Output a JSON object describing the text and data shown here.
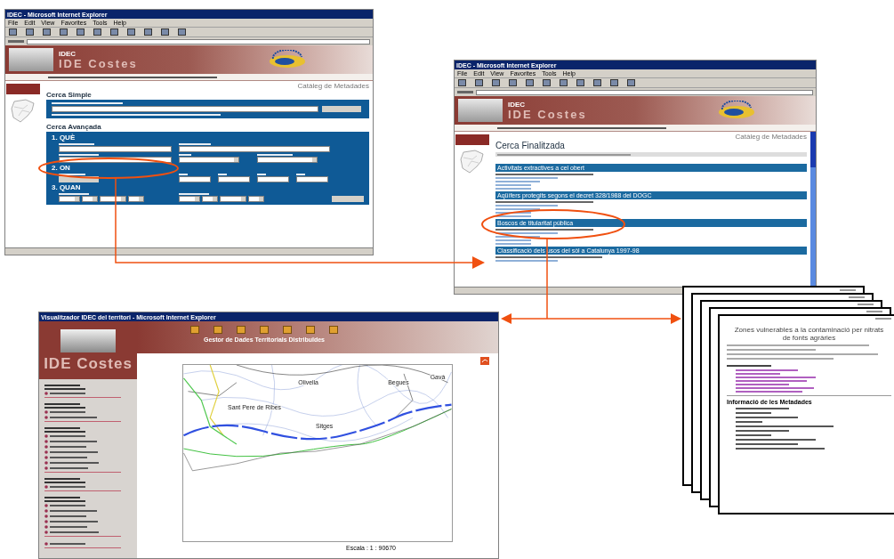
{
  "search_window": {
    "chrome": {
      "title": "IDEC - Microsoft Internet Explorer",
      "menu": [
        "File",
        "Edit",
        "View",
        "Favorites",
        "Tools",
        "Help"
      ]
    },
    "site": {
      "org": "IDEC",
      "name": "IDE Costes",
      "section": "Catàleg de Metadades"
    },
    "simple": {
      "heading": "Cerca Simple"
    },
    "advanced": {
      "heading": "Cerca Avançada",
      "steps": [
        "1. QUÈ",
        "2. ON",
        "3. QUAN"
      ]
    }
  },
  "results_window": {
    "chrome": {
      "title": "IDEC - Microsoft Internet Explorer",
      "menu": [
        "File",
        "Edit",
        "View",
        "Favorites",
        "Tools",
        "Help"
      ]
    },
    "site": {
      "org": "IDEC",
      "name": "IDE Costes",
      "section": "Catàleg de Metadades"
    },
    "heading": "Cerca Finalitzada",
    "results": [
      "Activitats extractives a cel obert",
      "Aqüífers protegits segons el decret 328/1988 del DOGC",
      "Boscos de titularitat pública",
      "Classificació dels usos del sòl a Catalunya 1997-98"
    ]
  },
  "viewer_window": {
    "title": "Visualitzador IDEC del territori - Microsoft Internet Explorer",
    "site_name": "IDE Costes",
    "header": "Gestor de Dades Territorials Distribuïdes",
    "places": [
      "Olivella",
      "Begues",
      "Gavà",
      "Sant Pere de Ribes",
      "Sitges"
    ],
    "scale": "Escala : 1 : 90670"
  },
  "documents": {
    "title": "Zones vulnerables a la contaminació per nitrats de fonts agràries",
    "section": "Informació de les Metadades"
  }
}
